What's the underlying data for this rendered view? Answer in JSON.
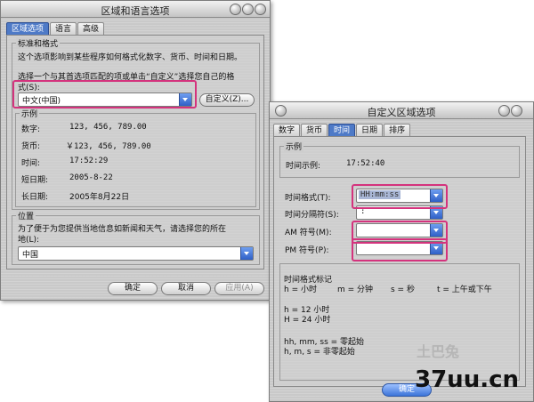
{
  "win1": {
    "title": "区域和语言选项",
    "tabs": [
      "区域选项",
      "语言",
      "高级"
    ],
    "standards": {
      "label": "标准和格式",
      "desc1": "这个选项影响到某些程序如何格式化数字、货币、时间和日期。",
      "desc2": "选择一个与其首选项匹配的项或单击“自定义”选择您自己的格",
      "desc3": "式(S):",
      "selected": "中文(中国)",
      "customize": "自定义(Z)..."
    },
    "sample": {
      "label": "示例",
      "rows": [
        {
          "k": "数字:",
          "v": "123, 456, 789.00"
        },
        {
          "k": "货币:",
          "v": "￥123, 456, 789.00"
        },
        {
          "k": "时间:",
          "v": "17:52:29"
        },
        {
          "k": "短日期:",
          "v": "2005-8-22"
        },
        {
          "k": "长日期:",
          "v": "2005年8月22日"
        }
      ]
    },
    "location": {
      "label": "位置",
      "desc1": "为了便于为您提供当地信息如新闻和天气，请选择您的所在",
      "desc2": "地(L):",
      "selected": "中国"
    },
    "buttons": {
      "ok": "确定",
      "cancel": "取消",
      "apply": "应用(A)"
    }
  },
  "win2": {
    "title": "自定义区域选项",
    "tabs": [
      "数字",
      "货币",
      "时间",
      "日期",
      "排序"
    ],
    "sample": {
      "label": "示例",
      "key": "时间示例:",
      "value": "17:52:40"
    },
    "fields": [
      {
        "label": "时间格式(T):",
        "value": "HH:mm:ss"
      },
      {
        "label": "时间分隔符(S):",
        "value": ":"
      },
      {
        "label": "AM 符号(M):",
        "value": ""
      },
      {
        "label": "PM 符号(P):",
        "value": ""
      }
    ],
    "notation": {
      "title": "时间格式标记",
      "line1a": "h = 小时",
      "line1b": "m = 分钟",
      "line1c": "s = 秒",
      "line1d": "t = 上午或下午",
      "line2": "h = 12 小时",
      "line3": "H = 24 小时",
      "line4": "hh, mm, ss = 零起始",
      "line5": "h, m, s = 非零起始"
    },
    "buttons": {
      "ok": "确定"
    }
  },
  "watermark": {
    "text": "37uu.cn",
    "faint": "土巴兔"
  },
  "colors": {
    "highlight": "#d4337d",
    "tab_active": "#4e7ac7"
  }
}
